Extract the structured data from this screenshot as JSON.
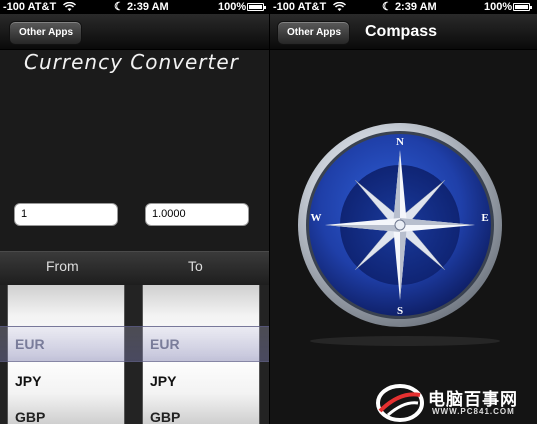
{
  "status_bar": {
    "carrier": "-100 AT&T",
    "time": "2:39 AM",
    "battery": "100%"
  },
  "left_screen": {
    "nav": {
      "back_label": "Other Apps"
    },
    "app_title": "Currency Converter",
    "from_amount": "1",
    "to_amount": "1.0000",
    "columns": {
      "from": "From",
      "to": "To"
    },
    "from_picker": [
      "EUR",
      "JPY",
      "GBP"
    ],
    "to_picker": [
      "EUR",
      "JPY",
      "GBP"
    ],
    "selected_index": 0
  },
  "right_screen": {
    "nav": {
      "back_label": "Other Apps",
      "title": "Compass"
    },
    "compass": {
      "north": "N",
      "south": "S",
      "east": "E",
      "west": "W"
    }
  },
  "watermark": {
    "text": "电脑百事网",
    "url": "WWW.PC841.COM"
  },
  "colors": {
    "compass_blue": "#1f3fa8",
    "compass_rim": "#c9cfd8",
    "watermark_accent": "#e53030"
  }
}
